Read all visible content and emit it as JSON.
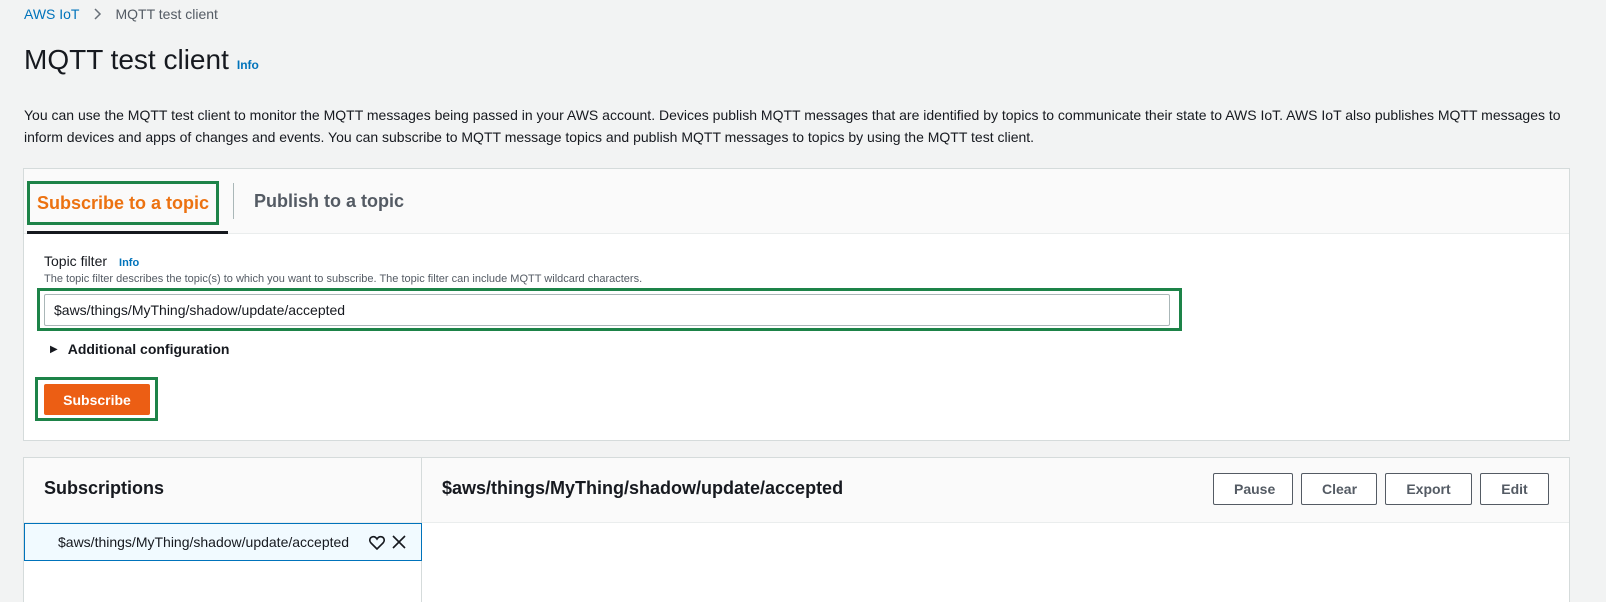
{
  "breadcrumb": {
    "root": "AWS IoT",
    "current": "MQTT test client"
  },
  "page": {
    "title": "MQTT test client",
    "info": "Info",
    "description": "You can use the MQTT test client to monitor the MQTT messages being passed in your AWS account. Devices publish MQTT messages that are identified by topics to communicate their state to AWS IoT. AWS IoT also publishes MQTT messages to inform devices and apps of changes and events. You can subscribe to MQTT message topics and publish MQTT messages to topics by using the MQTT test client."
  },
  "tabs": [
    {
      "label": "Subscribe to a topic",
      "active": true
    },
    {
      "label": "Publish to a topic",
      "active": false
    }
  ],
  "subscribe_form": {
    "topic_filter_label": "Topic filter",
    "info": "Info",
    "topic_filter_description": "The topic filter describes the topic(s) to which you want to subscribe. The topic filter can include MQTT wildcard characters.",
    "topic_filter_value": "$aws/things/MyThing/shadow/update/accepted",
    "additional_configuration": "Additional configuration",
    "subscribe_label": "Subscribe"
  },
  "subscriptions": {
    "title": "Subscriptions",
    "items": [
      {
        "topic": "$aws/things/MyThing/shadow/update/accepted"
      }
    ]
  },
  "messages": {
    "title": "$aws/things/MyThing/shadow/update/accepted",
    "actions": {
      "pause": "Pause",
      "clear": "Clear",
      "export": "Export",
      "edit": "Edit"
    }
  },
  "colors": {
    "accent_orange": "#ec7211",
    "button_orange": "#ec5e14",
    "link_blue": "#0073bb",
    "highlight_green": "#1d8348"
  },
  "icons": [
    "chevron-right-icon",
    "caret-right-icon",
    "heart-icon",
    "close-icon"
  ]
}
